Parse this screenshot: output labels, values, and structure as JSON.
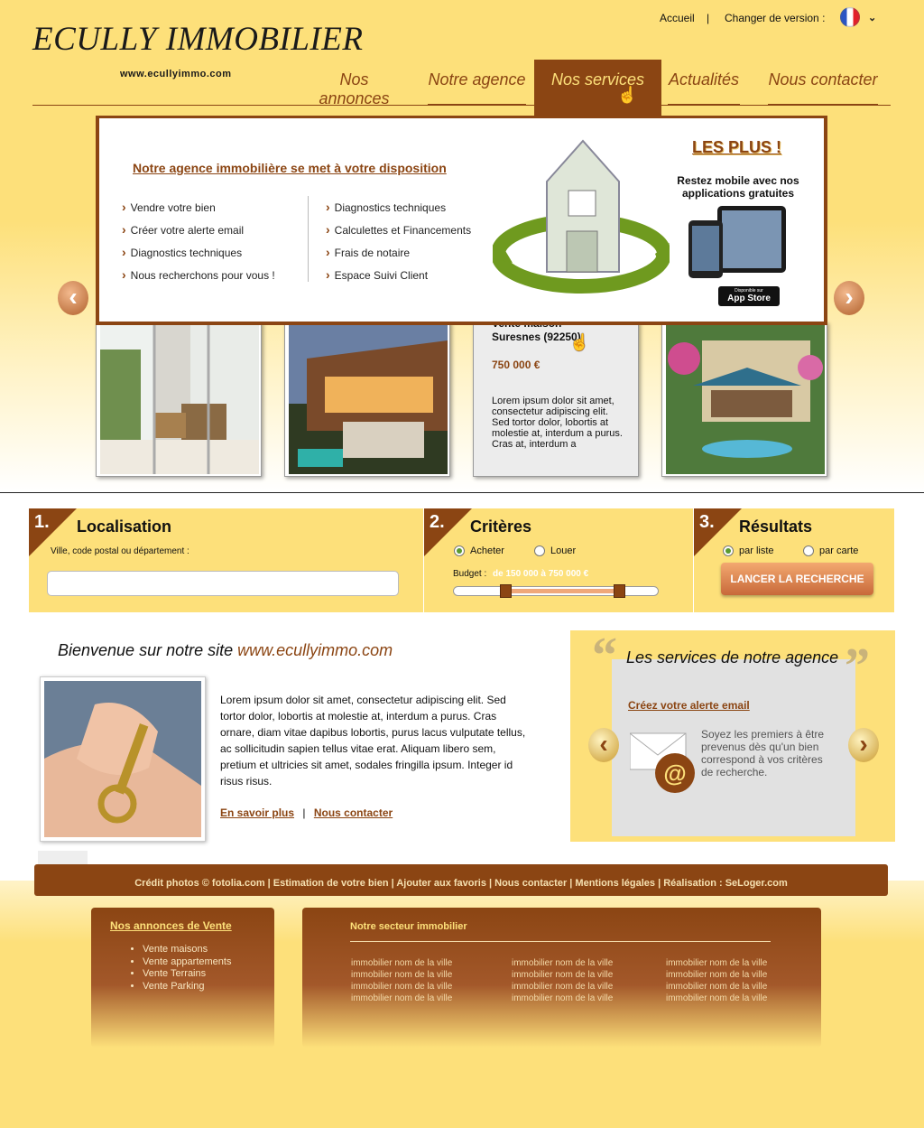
{
  "header": {
    "logo": "ECULLY IMMOBILIER",
    "url": "www.ecullyimmo.com",
    "accueil": "Accueil",
    "separator": "|",
    "version_label": "Changer de version :"
  },
  "nav": [
    "Nos annonces",
    "Notre agence",
    "Nos services",
    "Actualités",
    "Nous contacter"
  ],
  "services_panel": {
    "title": "Notre agence immobilière se met à votre disposition",
    "col1": [
      "Vendre votre bien",
      "Créer votre alerte email",
      "Diagnostics techniques",
      "Nous recherchons pour vous !"
    ],
    "col2": [
      "Diagnostics techniques",
      "Calculettes et Financements",
      "Frais de notaire",
      "Espace Suivi Client"
    ],
    "les_plus": "LES PLUS !",
    "mobile_text": "Restez mobile avec nos applications gratuites",
    "appstore_small": "Disponible sur",
    "appstore": "App Store"
  },
  "listing": {
    "title": "Vente maison Suresnes (92250)",
    "price": "750 000 €",
    "desc": "Lorem ipsum dolor sit amet, consectetur adipiscing elit. Sed tortor dolor, lobortis at molestie at, interdum a purus. Cras at, interdum a"
  },
  "search": {
    "step1_num": "1.",
    "step1_title": "Localisation",
    "step1_label": "Ville, code postal ou département :",
    "step2_num": "2.",
    "step2_title": "Critères",
    "acheter": "Acheter",
    "louer": "Louer",
    "budget_label": "Budget :",
    "budget_range": "de 150 000 à 750 000 €",
    "step3_num": "3.",
    "step3_title": "Résultats",
    "par_liste": "par liste",
    "par_carte": "par carte",
    "launch": "LANCER LA RECHERCHE"
  },
  "welcome": {
    "title": "Bienvenue sur notre site",
    "site": "www.ecullyimmo.com",
    "text": "Lorem ipsum dolor sit amet, consectetur adipiscing elit. Sed tortor dolor, lobortis at molestie at, interdum a purus. Cras ornare, diam vitae dapibus lobortis, purus lacus vulputate tellus, ac sollicitudin sapien tellus vitae erat. Aliquam libero sem, pretium et ultricies sit amet, sodales fringilla ipsum. Integer id risus risus.",
    "more": "En savoir plus",
    "sep": "|",
    "contact": "Nous contacter"
  },
  "services_box": {
    "title": "Les services de notre agence",
    "link": "Créez votre alerte email",
    "text": "Soyez les premiers à être prevenus dès qu'un bien correspond à vos critères de recherche."
  },
  "footer": {
    "bar": "Crédit photos © fotolia.com | Estimation de votre bien | Ajouter aux favoris | Nous contacter | Mentions légales | Réalisation : SeLoger.com",
    "annonces_title": "Nos annonces de Vente",
    "annonces": [
      "Vente maisons",
      "Vente appartements",
      "Vente Terrains",
      "Vente Parking"
    ],
    "secteur_title": "Notre secteur immobilier",
    "city_link": "immobilier nom de la ville"
  },
  "colors": {
    "brand": "#8b4513",
    "background": "#fde07a",
    "accent": "#f0a87a"
  }
}
